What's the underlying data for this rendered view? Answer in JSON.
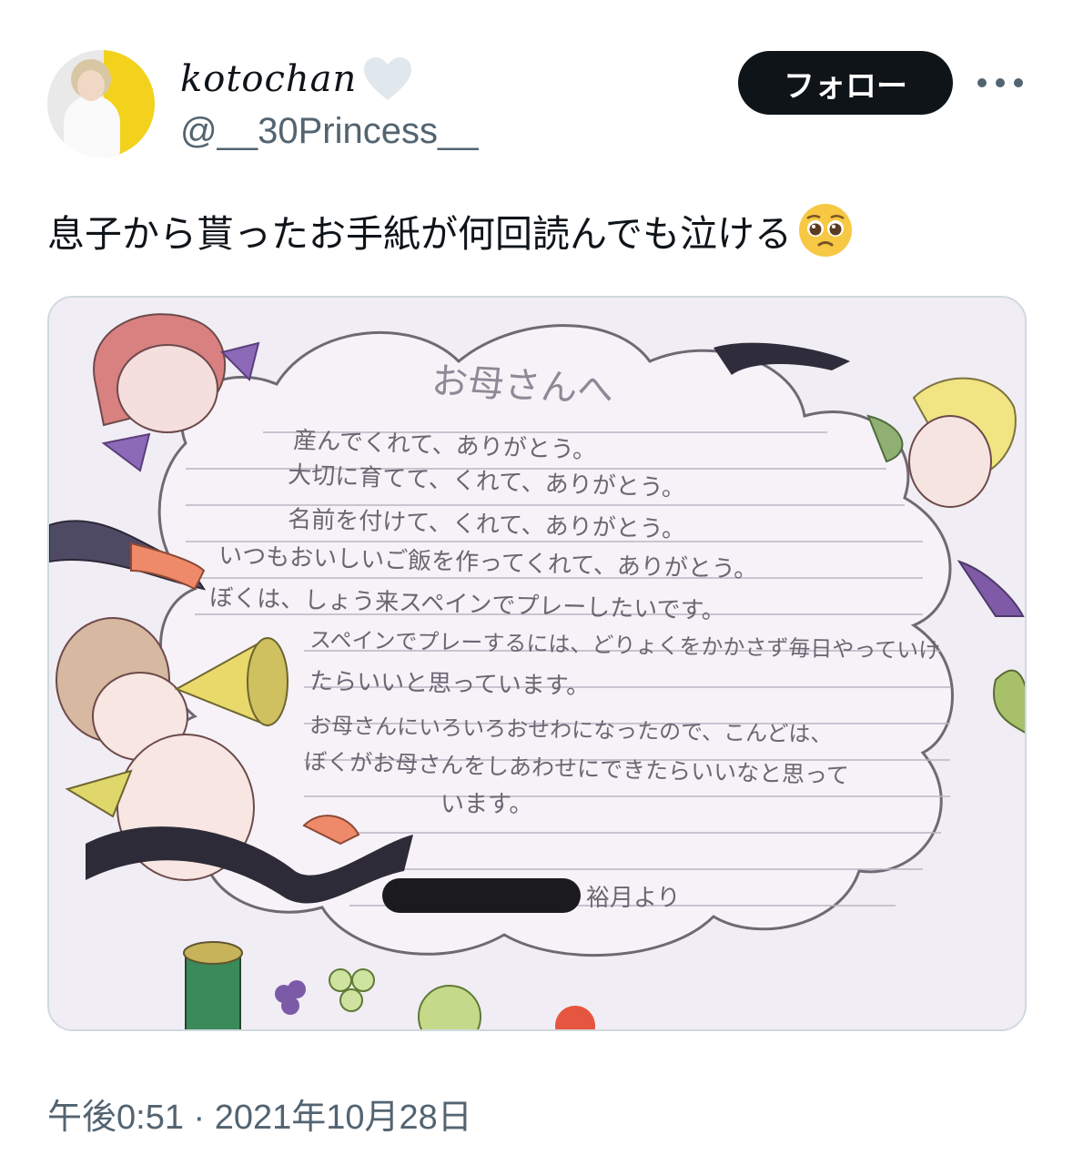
{
  "user": {
    "display_name": "kotochan",
    "name_icon": "white-heart-icon",
    "handle": "@__30Princess__",
    "avatar_icon": "avatar"
  },
  "follow_label": "フォロー",
  "more_icon": "more-dots-icon",
  "tweet": {
    "text": "息子から貰ったお手紙が何回読んでも泣ける",
    "emoji": "pleading-face-icon"
  },
  "letter": {
    "title": "お母さんへ",
    "lines": [
      "産んでくれて、ありがとう。",
      "大切に育てて、くれて、ありがとう。",
      "名前を付けて、くれて、ありがとう。",
      "いつもおいしいご飯を作ってくれて、ありがとう。",
      "ぼくは、しょう来スペインでプレーしたいです。",
      "スペインでプレーするには、どりょくをかかさず毎日やっていけ",
      "たらいいと思っています。",
      "お母さんにいろいろおせわになったので、こんどは、",
      "ぼくがお母さんをしあわせにできたらいいなと思って",
      "います。"
    ],
    "signature": "裕月より"
  },
  "timestamp": "午後0:51 · 2021年10月28日"
}
